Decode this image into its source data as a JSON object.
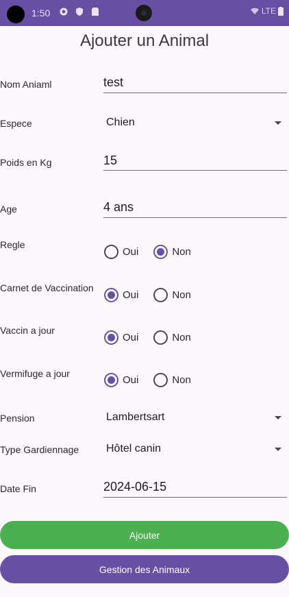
{
  "status_bar": {
    "time": "1:50",
    "network": "LTE"
  },
  "title": "Ajouter un Animal",
  "form": {
    "nom": {
      "label": "Nom Aniaml",
      "value": "test"
    },
    "espece": {
      "label": "Espece",
      "value": "Chien"
    },
    "poids": {
      "label": "Poids en Kg",
      "value": "15"
    },
    "age": {
      "label": "Age",
      "value": "4 ans"
    },
    "regle": {
      "label": "Regle",
      "options": [
        "Oui",
        "Non"
      ],
      "selected": "Non"
    },
    "carnet": {
      "label": "Carnet de Vaccination",
      "options": [
        "Oui",
        "Non"
      ],
      "selected": "Oui"
    },
    "vaccin": {
      "label": "Vaccin a jour",
      "options": [
        "Oui",
        "Non"
      ],
      "selected": "Oui"
    },
    "vermifuge": {
      "label": "Vermifuge a jour",
      "options": [
        "Oui",
        "Non"
      ],
      "selected": "Oui"
    },
    "pension": {
      "label": "Pension",
      "value": "Lambertsart"
    },
    "gardiennage": {
      "label": "Type Gardiennage",
      "value": "Hôtel canin"
    },
    "date_fin": {
      "label": "Date Fin",
      "value": "2024-06-15"
    }
  },
  "buttons": {
    "ajouter": "Ajouter",
    "gestion": "Gestion des Animaux"
  },
  "colors": {
    "primary": "#6750a4",
    "success": "#4caf50",
    "background": "#fdf7fe"
  }
}
